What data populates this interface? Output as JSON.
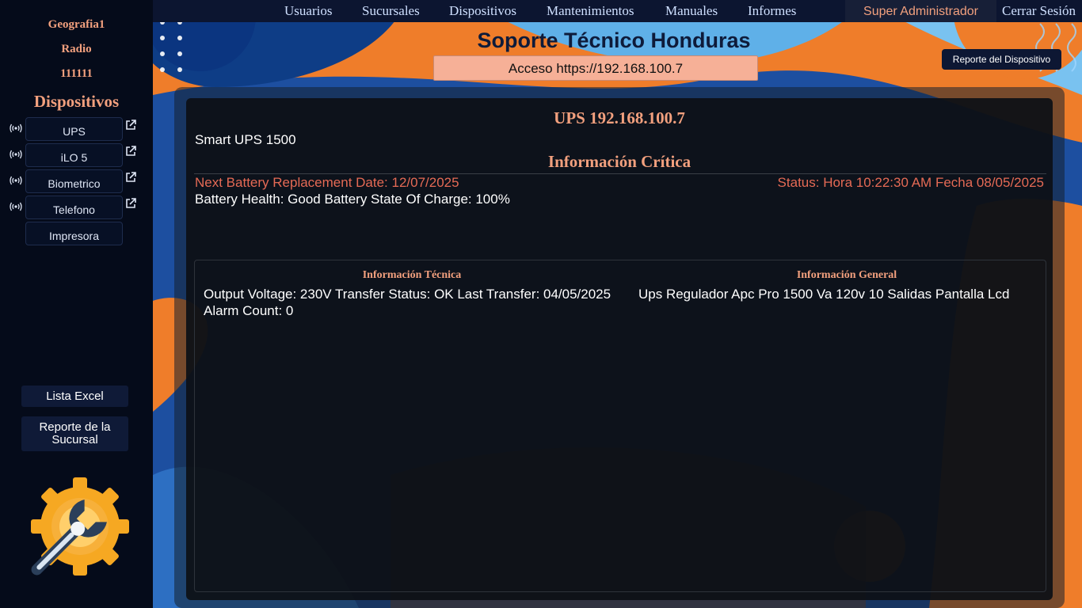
{
  "sidebar": {
    "branch_name": "Geografia1",
    "branch_type": "Radio",
    "branch_code": "111111",
    "devices_title": "Dispositivos",
    "devices": [
      {
        "label": "UPS",
        "has_link": true
      },
      {
        "label": "iLO 5",
        "has_link": true
      },
      {
        "label": "Biometrico",
        "has_link": true
      },
      {
        "label": "Telefono",
        "has_link": true
      },
      {
        "label": "Impresora",
        "has_link": false
      }
    ],
    "excel_button": "Lista Excel",
    "branch_report_button": "Reporte de la Sucursal",
    "icons": {
      "device_status": "wireless-signal-icon",
      "open": "external-link-icon",
      "logo": "wrench-gear-logo"
    }
  },
  "nav": {
    "items": [
      "Usuarios",
      "Sucursales",
      "Dispositivos",
      "Mantenimientos",
      "Manuales",
      "Informes"
    ],
    "user_role": "Super Administrador",
    "logout": "Cerrar Sesión"
  },
  "header": {
    "title": "Soporte Técnico Honduras",
    "access": "Acceso https://192.168.100.7",
    "device_report_button": "Reporte del Dispositivo"
  },
  "device": {
    "title": "UPS 192.168.100.7",
    "model": "Smart UPS 1500",
    "critical_title": "Información Crítica",
    "next_battery": "Next Battery Replacement Date: 12/07/2025",
    "status": "Status: Hora 10:22:30 AM Fecha 08/05/2025",
    "health": "Battery Health: Good Battery State Of Charge: 100%",
    "tech_title": "Información Técnica",
    "tech_text": "Output Voltage: 230V Transfer Status: OK Last Transfer: 04/05/2025 Alarm Count: 0",
    "general_title": "Información General",
    "general_text": "Ups Regulador Apc Pro 1500 Va 120v 10 Salidas Pantalla Lcd"
  },
  "colors": {
    "sidebar_bg": "#050b1a",
    "accent": "#f2a07e",
    "alert": "#e56a55",
    "nav_text": "#cfe0ff",
    "panel_bg": "#0d1016"
  }
}
